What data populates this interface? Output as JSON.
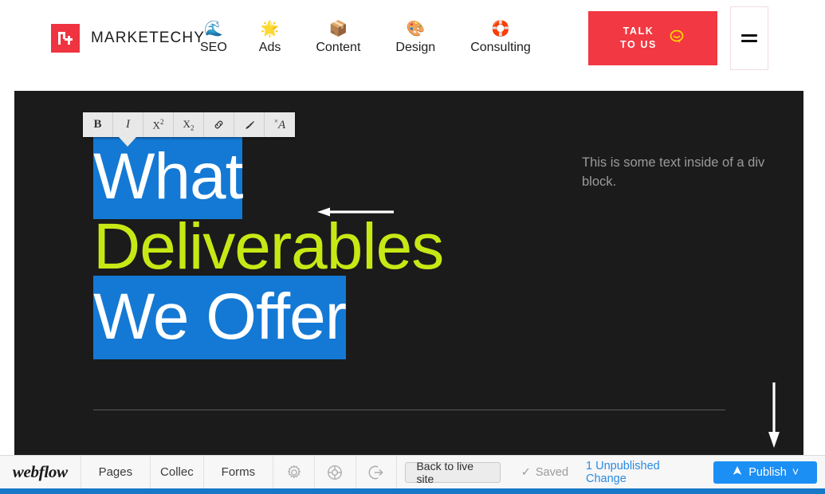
{
  "site_header": {
    "brand": {
      "logo_icon": "marketechy-monogram-logo",
      "name": "MARKETECHY"
    },
    "nav_items": [
      {
        "label": "SEO",
        "icon": "wave-icon",
        "glyph": "🌊"
      },
      {
        "label": "Ads",
        "icon": "sparkle-star-icon",
        "glyph": "🌟"
      },
      {
        "label": "Content",
        "icon": "package-box-icon",
        "glyph": "📦"
      },
      {
        "label": "Design",
        "icon": "artist-palette-icon",
        "glyph": "🎨"
      },
      {
        "label": "Consulting",
        "icon": "lifebuoy-icon",
        "glyph": "🛟"
      }
    ],
    "cta": {
      "line1": "TALK",
      "line2": "TO US",
      "icon": "speech-bubble-icon",
      "bg_color": "#f23842"
    },
    "menu_button": {
      "icon": "hamburger-menu-icon"
    }
  },
  "canvas": {
    "background_color": "#1b1b1b",
    "rich_text_toolbar": {
      "buttons": [
        {
          "name": "bold",
          "label": "B"
        },
        {
          "name": "italic",
          "label": "I"
        },
        {
          "name": "superscript",
          "label": "X",
          "script": "2"
        },
        {
          "name": "subscript",
          "label": "X",
          "script": "2"
        },
        {
          "name": "link",
          "label": "link-icon"
        },
        {
          "name": "paintbrush",
          "label": "paintbrush-icon"
        },
        {
          "name": "clear-formatting",
          "label": "ˣA"
        }
      ]
    },
    "headline": {
      "line1": "What",
      "line2": "Deliverables",
      "line3": "We Offer",
      "selection_color": "#1479d4",
      "selected_text_color": "#ffffff",
      "accent_color": "#c8e815"
    },
    "side_text": "This is some text inside of a div block.",
    "annotations": [
      {
        "name": "arrow-to-toolbar",
        "direction": "left",
        "color": "#ffffff"
      },
      {
        "name": "arrow-to-bottom-right",
        "direction": "down",
        "color": "#ffffff"
      }
    ]
  },
  "webflow_bar": {
    "logo": "webflow",
    "tabs": [
      {
        "label": "Pages",
        "name": "pages"
      },
      {
        "label": "Collec",
        "name": "collections"
      },
      {
        "label": "Forms",
        "name": "forms"
      }
    ],
    "icons": [
      {
        "name": "settings-gear-icon"
      },
      {
        "name": "help-lifebuoy-icon"
      },
      {
        "name": "share-export-icon"
      }
    ],
    "back_to_live": "Back to live site",
    "saved_status": "Saved",
    "saved_check": "✓",
    "unpublished_changes": "1 Unpublished Change",
    "publish_label": "Publish",
    "publish_icon": "webflow-rocket-icon",
    "publish_caret": "˅",
    "publish_color": "#1c8ff5",
    "link_color": "#2b8ae2"
  }
}
